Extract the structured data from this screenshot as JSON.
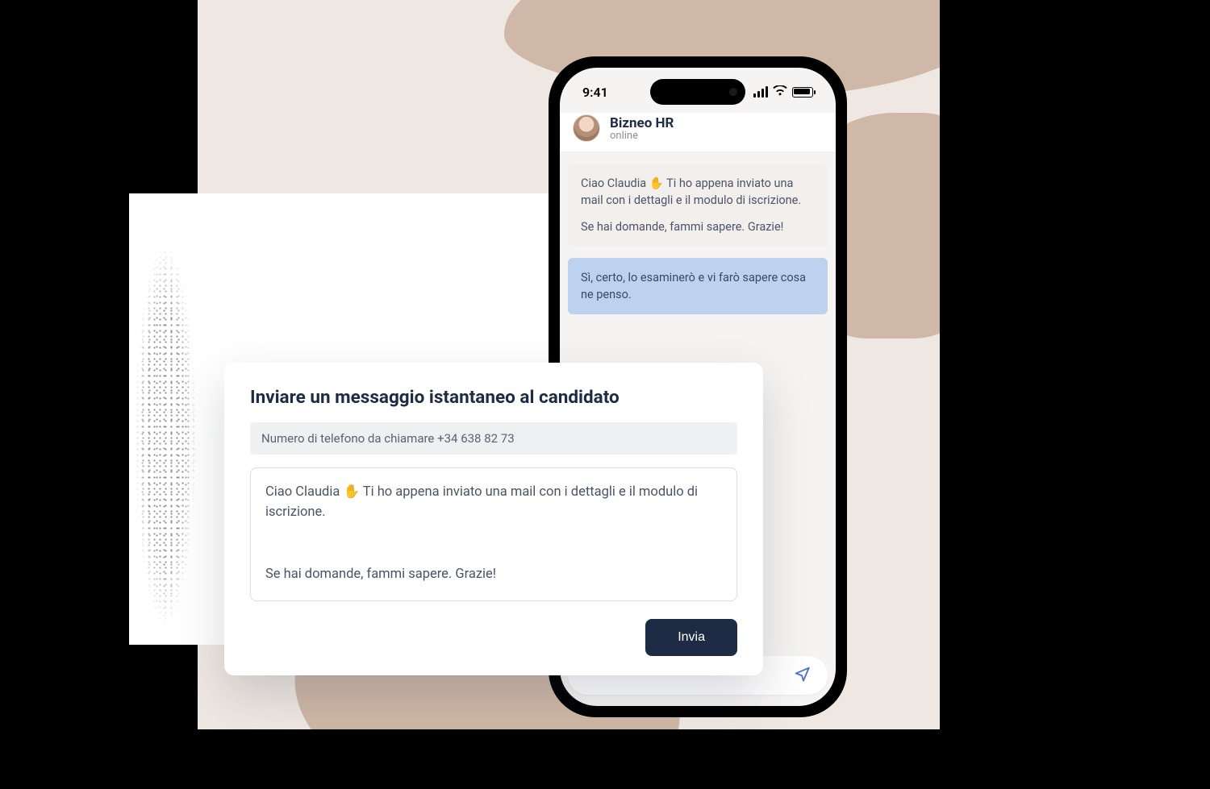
{
  "status_bar": {
    "time": "9:41"
  },
  "chat": {
    "title": "Bizneo HR",
    "status": "online",
    "messages": {
      "incoming_line1": "Ciao Claudia ✋ Ti ho appena inviato una mail con i dettagli e il modulo di iscrizione.",
      "incoming_line2": "Se hai domande, fammi sapere. Grazie!",
      "outgoing": "Sì, certo, lo esaminerò e vi farò sapere cosa ne penso."
    }
  },
  "dialog": {
    "title": "Inviare un messaggio istantaneo al candidato",
    "phone_label": "Numero di telefono da chiamare +34 638 82 73",
    "draft_line1": "Ciao Claudia ✋ Ti ho appena inviato una mail con i dettagli e il modulo di iscrizione.",
    "draft_line2": "Se hai domande, fammi sapere. Grazie!",
    "send_label": "Invia"
  }
}
